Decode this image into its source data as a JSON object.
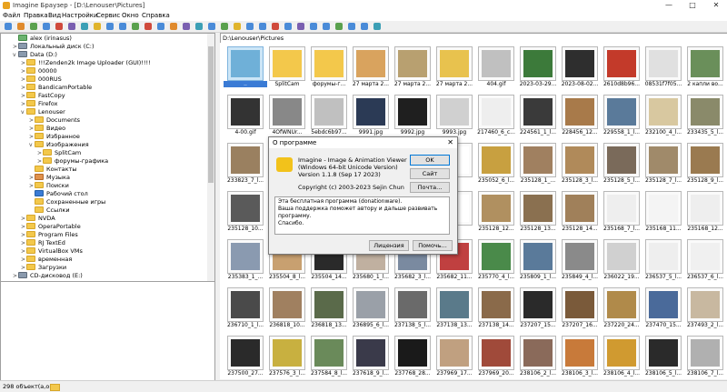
{
  "window": {
    "title": "Imagine Браузер - [D:\\Lenouser\\Pictures]",
    "minimize_glyph": "—",
    "maximize_glyph": "□",
    "close_glyph": "✕"
  },
  "menu": [
    "Файл",
    "Правка",
    "Вид",
    "Настройки",
    "Сервис",
    "Окно",
    "Справка"
  ],
  "toolbar_colors": [
    "#4a8bd8",
    "#e08a2c",
    "#5aa14e",
    "#4a8bd8",
    "#d04a3c",
    "#7a5fb0",
    "#3c9fb5",
    "#e0b42c",
    "#4a8bd8",
    "#4a8bd8",
    "#5aa14e",
    "#d04a3c",
    "#4a8bd8",
    "#e08a2c",
    "#7a5fb0",
    "#3c9fb5",
    "#4a8bd8",
    "#5aa14e",
    "#e0b42c",
    "#4a8bd8",
    "#4a8bd8",
    "#d04a3c",
    "#4a8bd8",
    "#7a5fb0",
    "#4a8bd8",
    "#4a8bd8",
    "#5aa14e",
    "#4a8bd8",
    "#4a8bd8",
    "#3c9fb5"
  ],
  "tree": [
    {
      "label": "alex (irinasus)",
      "icon": "user",
      "exp": "",
      "indent": 1
    },
    {
      "label": "Локальный диск (C:)",
      "icon": "drive",
      "exp": ">",
      "indent": 1
    },
    {
      "label": "Data (D:)",
      "icon": "drive",
      "exp": "v",
      "indent": 1
    },
    {
      "label": "!!!Zenden2k Image Uploader (GUI)!!!!",
      "icon": "folder",
      "exp": ">",
      "indent": 2
    },
    {
      "label": "00000",
      "icon": "folder",
      "exp": ">",
      "indent": 2
    },
    {
      "label": "000RUS",
      "icon": "folder",
      "exp": ">",
      "indent": 2
    },
    {
      "label": "BandicamPortable",
      "icon": "folder",
      "exp": ">",
      "indent": 2
    },
    {
      "label": "FastCopy",
      "icon": "folder",
      "exp": ">",
      "indent": 2
    },
    {
      "label": "Firefox",
      "icon": "folder",
      "exp": ">",
      "indent": 2
    },
    {
      "label": "Lenouser",
      "icon": "folder",
      "exp": "v",
      "indent": 2
    },
    {
      "label": "Documents",
      "icon": "folder",
      "exp": ">",
      "indent": 3
    },
    {
      "label": "Видео",
      "icon": "folder",
      "exp": ">",
      "indent": 3
    },
    {
      "label": "Избранное",
      "icon": "folder",
      "exp": ">",
      "indent": 3
    },
    {
      "label": "Изображения",
      "icon": "folder",
      "exp": "v",
      "indent": 3
    },
    {
      "label": "SplitCam",
      "icon": "folder",
      "exp": ">",
      "indent": 4
    },
    {
      "label": "форумы-графика",
      "icon": "folder",
      "exp": ">",
      "indent": 4
    },
    {
      "label": "Контакты",
      "icon": "folder",
      "exp": "",
      "indent": 3
    },
    {
      "label": "Музыка",
      "icon": "music",
      "exp": ">",
      "indent": 3
    },
    {
      "label": "Поиски",
      "icon": "folder",
      "exp": ">",
      "indent": 3
    },
    {
      "label": "Рабочий стол",
      "icon": "desktop",
      "exp": "",
      "indent": 3
    },
    {
      "label": "Сохраненные игры",
      "icon": "folder",
      "exp": "",
      "indent": 3
    },
    {
      "label": "Ссылки",
      "icon": "folder",
      "exp": "",
      "indent": 3
    },
    {
      "label": "NVDA",
      "icon": "folder",
      "exp": ">",
      "indent": 2
    },
    {
      "label": "OperaPortable",
      "icon": "folder",
      "exp": ">",
      "indent": 2
    },
    {
      "label": "Program Files",
      "icon": "folder",
      "exp": ">",
      "indent": 2
    },
    {
      "label": "RJ TextEd",
      "icon": "folder",
      "exp": ">",
      "indent": 2
    },
    {
      "label": "VirtualBox VMs",
      "icon": "folder",
      "exp": ">",
      "indent": 2
    },
    {
      "label": "временная",
      "icon": "folder",
      "exp": ">",
      "indent": 2
    },
    {
      "label": "Загрузки",
      "icon": "folder",
      "exp": ">",
      "indent": 2
    },
    {
      "label": "CD-дисковод (E:)",
      "icon": "drive",
      "exp": ">",
      "indent": 1
    }
  ],
  "path": "D:\\Lenouser\\Pictures",
  "thumbnails": [
    {
      "cap": "..",
      "color": "#6fb0d8",
      "selected": true
    },
    {
      "cap": "SplitCam",
      "color": "#f3c84b"
    },
    {
      "cap": "форумы-г...",
      "color": "#f3c84b"
    },
    {
      "cap": "27 марта 2...",
      "color": "#d9a35e"
    },
    {
      "cap": "27 марта 2...",
      "color": "#b8a070"
    },
    {
      "cap": "27 марта 2...",
      "color": "#e8c24e"
    },
    {
      "cap": "404.gif",
      "color": "#c0c0c0"
    },
    {
      "cap": "2023-03-29...",
      "color": "#3c7a3a"
    },
    {
      "cap": "2023-08-02...",
      "color": "#2e2e2e"
    },
    {
      "cap": "2610d8b96...",
      "color": "#c33a2a"
    },
    {
      "cap": "08531f7f05...",
      "color": "#e0e0e0"
    },
    {
      "cap": "2 капли во...",
      "color": "#6a8f5a"
    },
    {
      "cap": "4-00.gif",
      "color": "#333333"
    },
    {
      "cap": "4OfWNUr...",
      "color": "#888888"
    },
    {
      "cap": "5ebdc6b97...",
      "color": "#c0c0c0"
    },
    {
      "cap": "9991.jpg",
      "color": "#2b3a55"
    },
    {
      "cap": "9992.jpg",
      "color": "#1f1f1f"
    },
    {
      "cap": "9993.jpg",
      "color": "#d0d0d0"
    },
    {
      "cap": "217460_6_c...",
      "color": "#eeeeee"
    },
    {
      "cap": "224561_1_l...",
      "color": "#3a3a3a"
    },
    {
      "cap": "228456_12...",
      "color": "#a87a4a"
    },
    {
      "cap": "229558_1_l...",
      "color": "#5a7a9a"
    },
    {
      "cap": "232100_4_l...",
      "color": "#d8c8a0"
    },
    {
      "cap": "233435_5_l...",
      "color": "#8a8a6a"
    },
    {
      "cap": "233823_7_l...",
      "color": "#9a8060"
    },
    {
      "cap": "",
      "color": "#ffffff"
    },
    {
      "cap": "",
      "color": "#ffffff"
    },
    {
      "cap": "",
      "color": "#ffffff"
    },
    {
      "cap": "",
      "color": "#ffffff"
    },
    {
      "cap": "",
      "color": "#ffffff"
    },
    {
      "cap": "235052_6_l...",
      "color": "#c8a040"
    },
    {
      "cap": "235128_1_...",
      "color": "#a08060"
    },
    {
      "cap": "235128_3_l...",
      "color": "#b08a5a"
    },
    {
      "cap": "235128_5_l...",
      "color": "#7a6a5a"
    },
    {
      "cap": "235128_7_l...",
      "color": "#a08a6a"
    },
    {
      "cap": "235128_9_l...",
      "color": "#9a7a50"
    },
    {
      "cap": "235128_10...",
      "color": "#5a5a5a"
    },
    {
      "cap": "",
      "color": "#ffffff"
    },
    {
      "cap": "",
      "color": "#ffffff"
    },
    {
      "cap": "",
      "color": "#ffffff"
    },
    {
      "cap": "",
      "color": "#ffffff"
    },
    {
      "cap": "",
      "color": "#ffffff"
    },
    {
      "cap": "235128_12...",
      "color": "#b09060"
    },
    {
      "cap": "235128_13...",
      "color": "#8a7050"
    },
    {
      "cap": "235128_14...",
      "color": "#a0805a"
    },
    {
      "cap": "235168_7_l...",
      "color": "#eeeeee"
    },
    {
      "cap": "235168_11...",
      "color": "#f4f4f4"
    },
    {
      "cap": "235168_12...",
      "color": "#eeeeee"
    },
    {
      "cap": "235383_1_...",
      "color": "#8a9ab0"
    },
    {
      "cap": "235504_8_l...",
      "color": "#c8a070"
    },
    {
      "cap": "235504_14...",
      "color": "#2a2a2a"
    },
    {
      "cap": "235680_1_l...",
      "color": "#c0b0a0"
    },
    {
      "cap": "235682_3_l...",
      "color": "#7a8aa0"
    },
    {
      "cap": "235682_11...",
      "color": "#c04040"
    },
    {
      "cap": "235770_4_l...",
      "color": "#4a8a4a"
    },
    {
      "cap": "235809_1_l...",
      "color": "#5a7a9a"
    },
    {
      "cap": "235849_4_l...",
      "color": "#8a8a8a"
    },
    {
      "cap": "236022_19...",
      "color": "#d0d0d0"
    },
    {
      "cap": "236537_5_l...",
      "color": "#eeeeee"
    },
    {
      "cap": "236537_6_l...",
      "color": "#f0f0f0"
    },
    {
      "cap": "236710_1_l...",
      "color": "#4a4a4a"
    },
    {
      "cap": "236818_10...",
      "color": "#a08060"
    },
    {
      "cap": "236818_13...",
      "color": "#5a6a4a"
    },
    {
      "cap": "236895_6_l...",
      "color": "#9aa0a8"
    },
    {
      "cap": "237138_5_l...",
      "color": "#6a6a6a"
    },
    {
      "cap": "237138_13...",
      "color": "#5a7a8a"
    },
    {
      "cap": "237138_14...",
      "color": "#8a6a4a"
    },
    {
      "cap": "237207_15...",
      "color": "#2a2a2a"
    },
    {
      "cap": "237207_16...",
      "color": "#7a5a3a"
    },
    {
      "cap": "237220_24...",
      "color": "#b08a4a"
    },
    {
      "cap": "237470_15...",
      "color": "#4a6a9a"
    },
    {
      "cap": "237493_2_l...",
      "color": "#c8b8a0"
    },
    {
      "cap": "237500_27...",
      "color": "#2a2a2a"
    },
    {
      "cap": "237576_3_l...",
      "color": "#c8b040"
    },
    {
      "cap": "237584_8_l...",
      "color": "#6a8a5a"
    },
    {
      "cap": "237618_9_l...",
      "color": "#3a3a4a"
    },
    {
      "cap": "237768_28...",
      "color": "#1a1a1a"
    },
    {
      "cap": "237969_17...",
      "color": "#c0a080"
    },
    {
      "cap": "237969_20...",
      "color": "#a04a3a"
    },
    {
      "cap": "238106_2_l...",
      "color": "#8a6a5a"
    },
    {
      "cap": "238106_3_l...",
      "color": "#c87a3a"
    },
    {
      "cap": "238106_4_l...",
      "color": "#d09a30"
    },
    {
      "cap": "238106_5_l...",
      "color": "#2a2a2a"
    },
    {
      "cap": "238106_7_l...",
      "color": "#b0b0b0"
    }
  ],
  "status": {
    "count": "298 объект(а,ов)"
  },
  "dialog": {
    "title": "О программе",
    "close_glyph": "✕",
    "lines": [
      "Imagine - Image & Animation Viewer",
      "(Windows 64-bit Unicode Version)",
      "Version 1.1.8 (Sep 17 2023)",
      "",
      "Copyright (c) 2003-2023 Sejin Chun"
    ],
    "text": [
      "Эта бесплатная программа (donationware).",
      "Ваша поддержка поможет автору и дальше развивать программу.",
      "Спасибо."
    ],
    "ok": "OK",
    "site": "Сайт",
    "mail": "Почта...",
    "license": "Лицензия",
    "help": "Помочь..."
  }
}
